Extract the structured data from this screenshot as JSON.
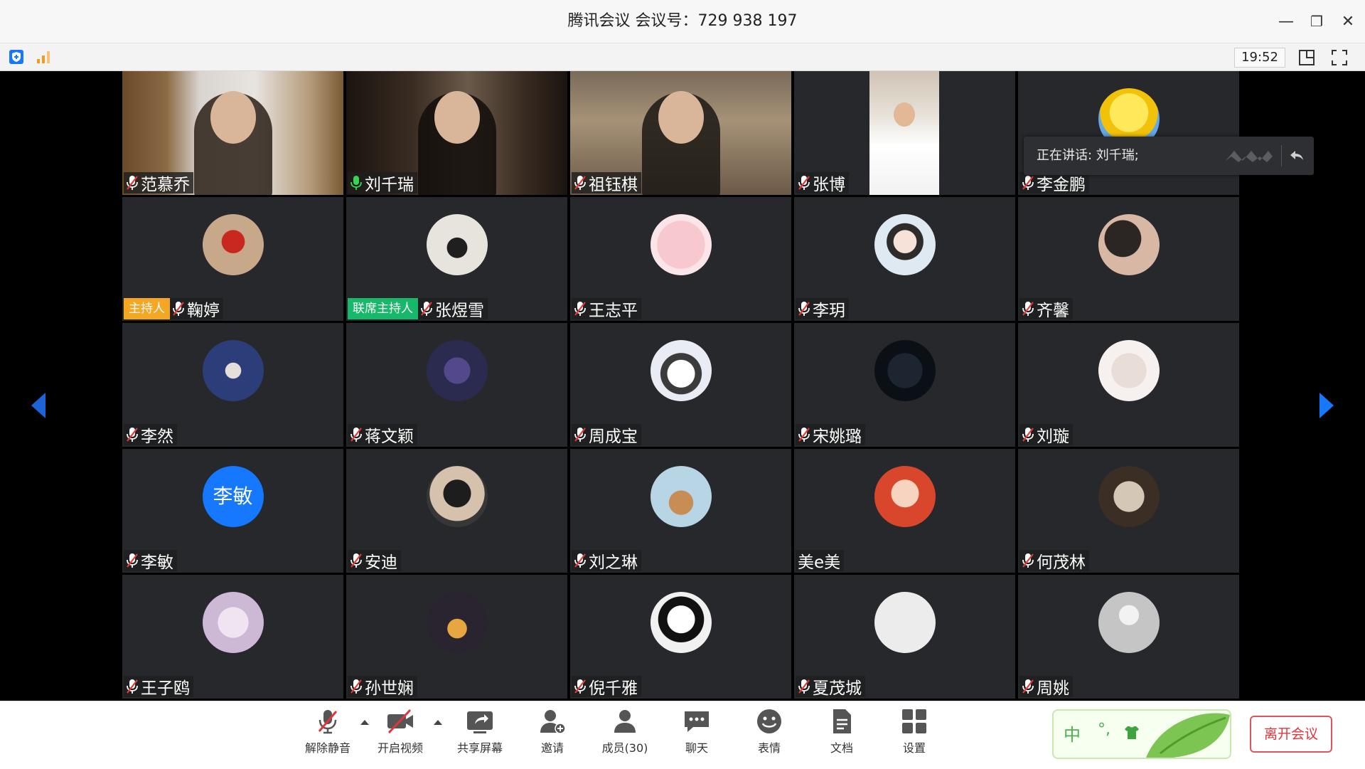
{
  "window": {
    "title": "腾讯会议 会议号：729 938 197",
    "minimize": "—",
    "maximize": "❐",
    "close": "✕"
  },
  "toolbar": {
    "time": "19:52"
  },
  "speaking": {
    "text": "正在讲话: 刘千瑞;"
  },
  "badges": {
    "host": "主持人",
    "cohost": "联席主持人"
  },
  "participants": [
    {
      "name": "范慕乔",
      "mic": "muted",
      "video": true
    },
    {
      "name": "刘千瑞",
      "mic": "on",
      "video": true
    },
    {
      "name": "祖钰棋",
      "mic": "muted",
      "video": true
    },
    {
      "name": "张博",
      "mic": "muted",
      "video": true
    },
    {
      "name": "李金鹏",
      "mic": "muted",
      "video": false
    },
    {
      "name": "鞠婷",
      "mic": "muted",
      "role": "host"
    },
    {
      "name": "张煜雪",
      "mic": "muted",
      "role": "cohost"
    },
    {
      "name": "王志平",
      "mic": "muted"
    },
    {
      "name": "李玥",
      "mic": "muted"
    },
    {
      "name": "齐馨",
      "mic": "muted"
    },
    {
      "name": "李然",
      "mic": "muted"
    },
    {
      "name": "蒋文颖",
      "mic": "muted"
    },
    {
      "name": "周成宝",
      "mic": "muted"
    },
    {
      "name": "宋姚璐",
      "mic": "muted"
    },
    {
      "name": "刘璇",
      "mic": "muted"
    },
    {
      "name": "李敏",
      "mic": "muted",
      "avatar_text": "李敏"
    },
    {
      "name": "安迪",
      "mic": "muted"
    },
    {
      "name": "刘之琳",
      "mic": "muted"
    },
    {
      "name": "美e美",
      "mic": "none"
    },
    {
      "name": "何茂林",
      "mic": "muted"
    },
    {
      "name": "王子鸥",
      "mic": "muted"
    },
    {
      "name": "孙世娴",
      "mic": "muted"
    },
    {
      "name": "倪千雅",
      "mic": "muted"
    },
    {
      "name": "夏茂城",
      "mic": "muted"
    },
    {
      "name": "周姚",
      "mic": "muted"
    }
  ],
  "controls": {
    "unmute": "解除静音",
    "start_video": "开启视频",
    "share_screen": "共享屏幕",
    "invite": "邀请",
    "members": "成员(30)",
    "chat": "聊天",
    "reactions": "表情",
    "docs": "文档",
    "settings": "设置",
    "leave": "离开会议"
  },
  "ime": {
    "lang": "中",
    "punct": "°,"
  },
  "colors": {
    "accent": "#1677ff",
    "host": "#f5a623",
    "cohost": "#18b86b",
    "leave": "#e0353c",
    "tile": "#26282c"
  }
}
